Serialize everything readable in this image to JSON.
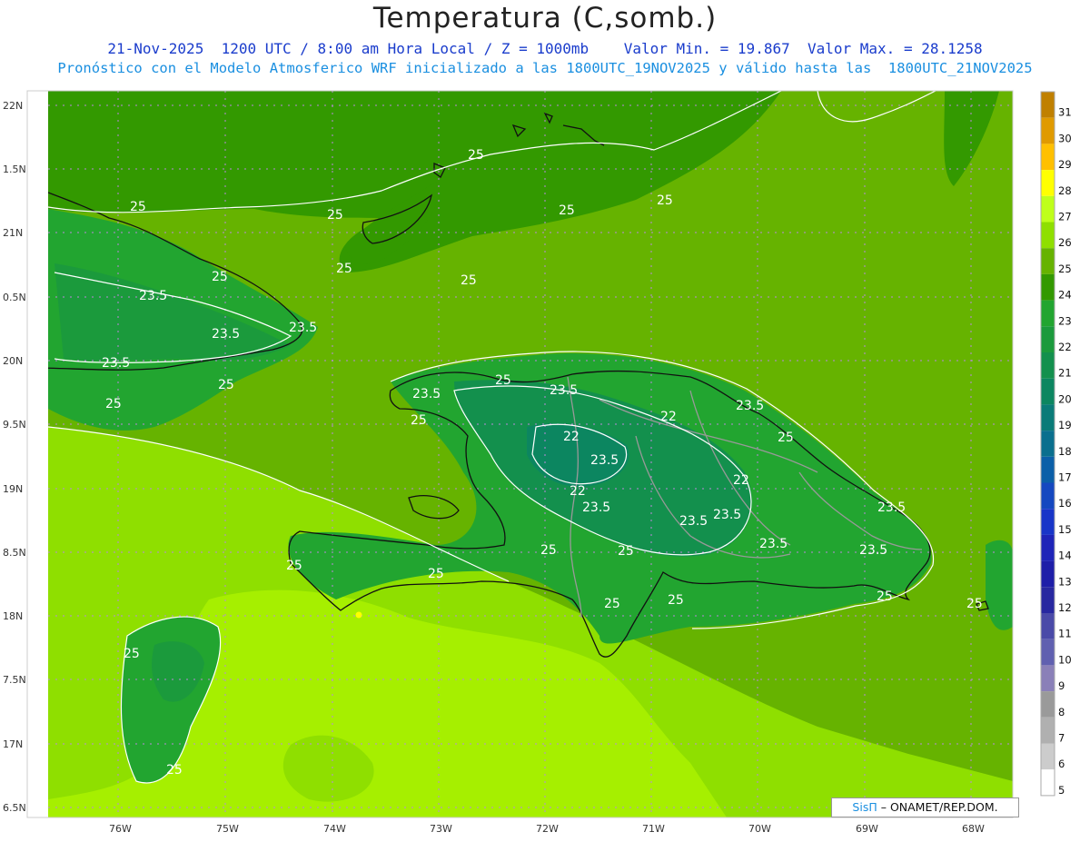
{
  "header": {
    "title": "Temperatura (C,somb.)",
    "subtitle_line1": "21-Nov-2025  1200 UTC / 8:00 am Hora Local / Z = 1000mb    Valor Min. = 19.867  Valor Max. = 28.1258",
    "subtitle_line2": "Pronóstico con el Modelo Atmosferico WRF inicializado a las 1800UTC_19NOV2025 y válido hasta las  1800UTC_21NOV2025"
  },
  "credit": {
    "logo": "SisΠ",
    "text": "– ONAMET/REP.DOM."
  },
  "axes": {
    "lat_labels": [
      "22N",
      "1.5N",
      "21N",
      "0.5N",
      "20N",
      "9.5N",
      "19N",
      "8.5N",
      "18N",
      "7.5N",
      "17N",
      "6.5N"
    ],
    "lon_labels": [
      "76W",
      "75W",
      "74W",
      "73W",
      "72W",
      "71W",
      "70W",
      "69W",
      "68W"
    ]
  },
  "colorbar": {
    "levels": [
      "31",
      "30",
      "29",
      "28",
      "27",
      "26",
      "25",
      "24",
      "23",
      "22",
      "21",
      "20",
      "19",
      "18",
      "17",
      "16",
      "15",
      "14",
      "13",
      "12",
      "11",
      "10",
      "9",
      "8",
      "7",
      "6",
      "5"
    ],
    "colors": [
      "#c08000",
      "#e09a00",
      "#ffc000",
      "#ffff00",
      "#bfff1a",
      "#8fdf00",
      "#66b300",
      "#339900",
      "#22a530",
      "#1b9a3c",
      "#13904d",
      "#0c8660",
      "#0a7b78",
      "#0a6f8e",
      "#0b5fa8",
      "#1548c0",
      "#1835c8",
      "#1e24b8",
      "#1e1ea8",
      "#2828a0",
      "#4a4aa8",
      "#6060b0",
      "#8a80b8",
      "#9a9a9a",
      "#b0b0b0",
      "#cccccc",
      "#ffffff"
    ]
  },
  "contour_labels": [
    "25",
    "25",
    "25",
    "25",
    "25",
    "25",
    "25",
    "23.5",
    "25",
    "23.5",
    "23.5",
    "23.5",
    "25",
    "25",
    "25",
    "23.5",
    "25",
    "25",
    "23.5",
    "22",
    "22",
    "23.5",
    "23.5",
    "22",
    "22",
    "23.5",
    "23.5",
    "23.5",
    "23.5",
    "25",
    "25",
    "25",
    "25",
    "25",
    "25",
    "25",
    "25",
    "25",
    "23.5",
    "23.5",
    "25"
  ]
}
